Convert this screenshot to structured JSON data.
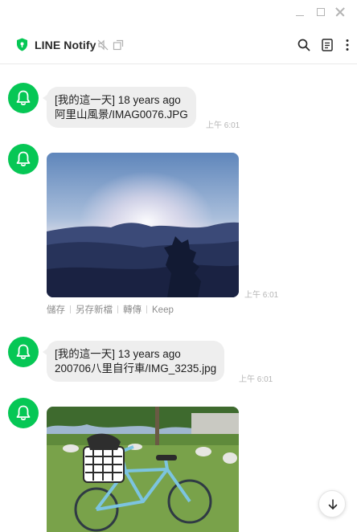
{
  "window": {
    "controls": [
      "minimize-icon",
      "maximize-icon",
      "close-icon"
    ]
  },
  "header": {
    "title": "LINE Notify",
    "icons": [
      "shield-icon",
      "mute-icon",
      "external-link-icon",
      "search-icon",
      "notes-icon",
      "more-icon"
    ]
  },
  "colors": {
    "brand_green": "#06c755",
    "bubble_bg": "#eeeeee",
    "time_text": "#b5b5b5"
  },
  "messages": [
    {
      "type": "text",
      "line1": "[我的這一天] 18 years ago",
      "line2": "阿里山風景/IMAG0076.JPG",
      "time": "上午 6:01"
    },
    {
      "type": "image",
      "image_desc": "mountain-sunrise-photo",
      "time": "上午 6:01",
      "actions": [
        "儲存",
        "另存新檔",
        "轉傳",
        "Keep"
      ]
    },
    {
      "type": "text",
      "line1": "[我的這一天] 13 years ago",
      "line2": "200706八里自行車/IMG_3235.jpg",
      "time": "上午 6:01"
    },
    {
      "type": "image",
      "image_desc": "bicycle-park-photo"
    }
  ],
  "scroll_button": "arrow-down-icon"
}
